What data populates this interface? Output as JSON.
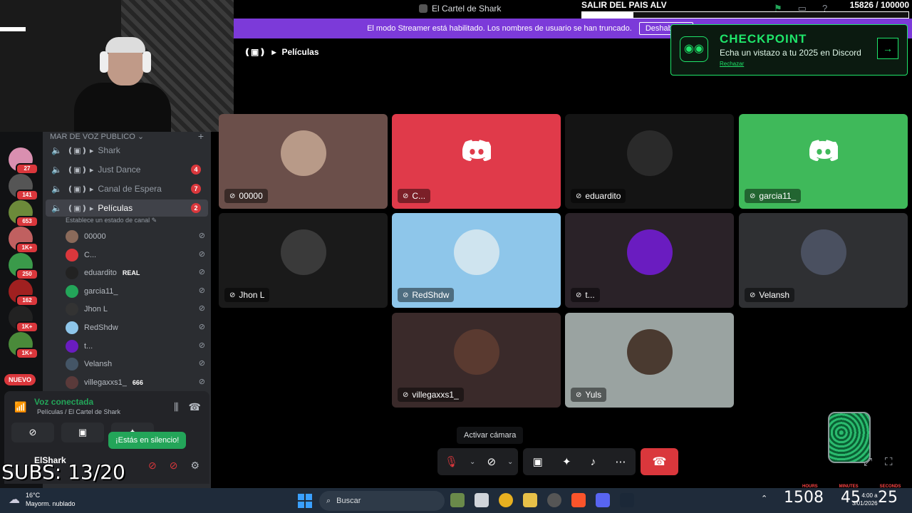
{
  "window": {
    "title": "El Cartel de Shark"
  },
  "overlay_goal": {
    "title": "SALIR DEL PAIS ALV",
    "count": "15826 / 100000",
    "progress": 0.158
  },
  "banner": {
    "text": "El modo Streamer está habilitado. Los nombres de usuario se han truncado.",
    "button": "Deshabilitar"
  },
  "checkpoint": {
    "title": "CHECKPOINT",
    "subtitle": "Echa un vistazo a tu 2025 en Discord",
    "dismiss": "Rechazar"
  },
  "stage": {
    "channel": "Películas"
  },
  "servers": [
    {
      "badge": "27",
      "color": "#d98fb0"
    },
    {
      "badge": "141",
      "color": "#555555"
    },
    {
      "badge": "653",
      "color": "#6c8a3a"
    },
    {
      "badge": "1K+",
      "color": "#c06060"
    },
    {
      "badge": "250",
      "color": "#3a9a4a"
    },
    {
      "badge": "162",
      "color": "#a02020"
    },
    {
      "badge": "1K+",
      "color": "#222222"
    },
    {
      "badge": "1K+",
      "color": "#4a8a3a"
    }
  ],
  "new_label": "NUEVO",
  "sidebar": {
    "category": "MAR DE VOZ PUBLICO",
    "channels": [
      {
        "name": "Shark",
        "badge": ""
      },
      {
        "name": "Just Dance",
        "badge": "4"
      },
      {
        "name": "Canal de Espera",
        "badge": "7"
      },
      {
        "name": "Películas",
        "badge": "2"
      }
    ],
    "channel_status": "Establece un estado de canal",
    "members": [
      {
        "name": "00000",
        "tag": "",
        "color": "#8a6a5a"
      },
      {
        "name": "C...",
        "tag": "",
        "color": "#da373c"
      },
      {
        "name": "eduardito",
        "tag": "REAL",
        "color": "#222222"
      },
      {
        "name": "garcia11_",
        "tag": "",
        "color": "#23a559"
      },
      {
        "name": "Jhon L",
        "tag": "",
        "color": "#333333"
      },
      {
        "name": "RedShdw",
        "tag": "",
        "color": "#8ec6ea"
      },
      {
        "name": "t...",
        "tag": "",
        "color": "#6a1cc0"
      },
      {
        "name": "Velansh",
        "tag": "",
        "color": "#445566"
      },
      {
        "name": "villegaxxs1_",
        "tag": "666",
        "color": "#5a3a3a"
      }
    ]
  },
  "voice": {
    "status": "Voz conectada",
    "location": "Películas / El Cartel de Shark"
  },
  "user": {
    "name": "ElShark"
  },
  "silence_tip": "¡Estás en silencio!",
  "subs": "SUBS: 13/20",
  "tiles": [
    {
      "name": "00000",
      "bg": "#6b4f4a",
      "kind": "photo",
      "av": "#b89a88"
    },
    {
      "name": "C...",
      "bg": "#e03a4a",
      "kind": "logo",
      "av": ""
    },
    {
      "name": "eduardito",
      "bg": "#141414",
      "kind": "photo",
      "av": "#2a2a2a"
    },
    {
      "name": "garcia11_",
      "bg": "#3fb95a",
      "kind": "logo",
      "av": ""
    },
    {
      "name": "Jhon L",
      "bg": "#1a1a1a",
      "kind": "photo",
      "av": "#3a3a3a"
    },
    {
      "name": "RedShdw",
      "bg": "#8ec6ea",
      "kind": "photo",
      "av": "#cfe4ef"
    },
    {
      "name": "t...",
      "bg": "#2a2228",
      "kind": "photo",
      "av": "#6a1cc0"
    },
    {
      "name": "Velansh",
      "bg": "#2f3033",
      "kind": "photo",
      "av": "#4a5060"
    },
    {
      "name": "villegaxxs1_",
      "bg": "#3a2a2a",
      "kind": "photo",
      "av": "#5a3a30"
    },
    {
      "name": "Yuls",
      "bg": "#9aa3a1",
      "kind": "photo",
      "av": "#4a3a30"
    }
  ],
  "camera_tooltip": "Activar cámara",
  "taskbar": {
    "weather_temp": "16°C",
    "weather_desc": "Mayorm. nublado",
    "search": "Buscar",
    "clock_h": "15",
    "clock_m": "08",
    "clock_s1": "45",
    "clock_s2": "25",
    "clock_label_h": "HOURS",
    "clock_label_m": "MINUTES",
    "clock_label_s": "SECONDS",
    "time_small": "4:00 a",
    "date_small": "3/01/2026"
  },
  "colors": {
    "accent_purple": "#7c3ad9",
    "discord_red": "#da373c",
    "discord_green": "#23a559",
    "checkpoint_green": "#1fe56a"
  }
}
